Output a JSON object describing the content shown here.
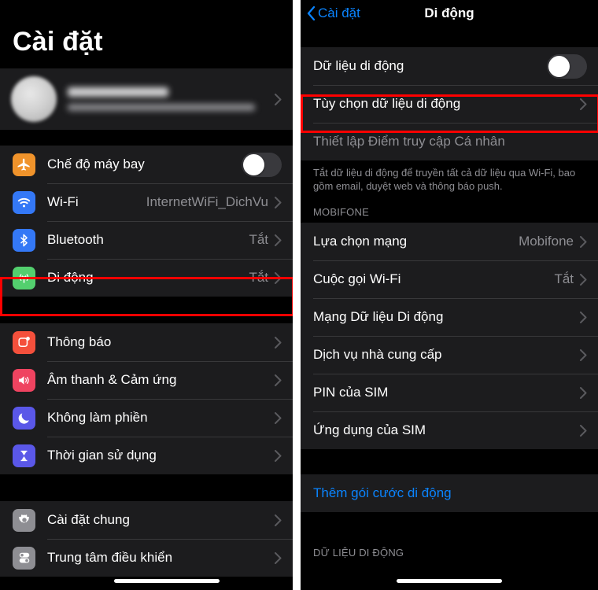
{
  "left_panel": {
    "title": "Cài đặt",
    "profile": {
      "name_redacted": "",
      "subtitle_redacted": ""
    },
    "group1": [
      {
        "label": "Chế độ máy bay",
        "control": "toggle",
        "toggle_on": false,
        "icon": "airplane-icon",
        "icon_color": "#f0932b"
      },
      {
        "label": "Wi-Fi",
        "value": "InternetWiFi_DichVu",
        "control": "chevron",
        "icon": "wifi-icon",
        "icon_color": "#3478f6"
      },
      {
        "label": "Bluetooth",
        "value": "Tắt",
        "control": "chevron",
        "icon": "bluetooth-icon",
        "icon_color": "#3478f6"
      },
      {
        "label": "Di động",
        "value": "Tắt",
        "control": "chevron",
        "icon": "cellular-icon",
        "icon_color": "#53cf6e",
        "highlighted": true
      }
    ],
    "group2": [
      {
        "label": "Thông báo",
        "control": "chevron",
        "icon": "notifications-icon",
        "icon_color": "#f4503c"
      },
      {
        "label": "Âm thanh & Cảm ứng",
        "control": "chevron",
        "icon": "sound-icon",
        "icon_color": "#ef4360"
      },
      {
        "label": "Không làm phiền",
        "control": "chevron",
        "icon": "moon-icon",
        "icon_color": "#5a57e8"
      },
      {
        "label": "Thời gian sử dụng",
        "control": "chevron",
        "icon": "hourglass-icon",
        "icon_color": "#5a57e8"
      }
    ],
    "group3": [
      {
        "label": "Cài đặt chung",
        "control": "chevron",
        "icon": "gear-icon",
        "icon_color": "#8e8e93"
      },
      {
        "label": "Trung tâm điều khiển",
        "control": "chevron",
        "icon": "control-center-icon",
        "icon_color": "#8e8e93"
      }
    ]
  },
  "right_panel": {
    "back_label": "Cài đặt",
    "nav_title": "Di động",
    "group1": [
      {
        "label": "Dữ liệu di động",
        "control": "toggle",
        "toggle_on": false
      },
      {
        "label": "Tùy chọn dữ liệu di động",
        "control": "chevron",
        "highlighted": true
      },
      {
        "label": "Thiết lập Điểm truy cập Cá nhân",
        "control": "none",
        "dimmed": true
      }
    ],
    "footer_note": "Tắt dữ liệu di động để truyền tất cả dữ liệu qua Wi-Fi, bao gồm email, duyệt web và thông báo push.",
    "section_header": "MOBIFONE",
    "group2": [
      {
        "label": "Lựa chọn mạng",
        "value": "Mobifone",
        "control": "chevron"
      },
      {
        "label": "Cuộc gọi Wi-Fi",
        "value": "Tắt",
        "control": "chevron"
      },
      {
        "label": "Mạng Dữ liệu Di động",
        "control": "chevron"
      },
      {
        "label": "Dịch vụ nhà cung cấp",
        "control": "chevron"
      },
      {
        "label": "PIN của SIM",
        "control": "chevron"
      },
      {
        "label": "Ứng dụng của SIM",
        "control": "chevron"
      }
    ],
    "group3": [
      {
        "label": "Thêm gói cước di động",
        "control": "none",
        "link": true
      }
    ],
    "bottom_section_header": "DỮ LIỆU DI ĐỘNG"
  },
  "colors": {
    "accent_blue": "#0a84ff",
    "highlight_red": "#ff0000",
    "list_bg": "#1c1c1e",
    "screen_bg": "#000000",
    "secondary_text": "#8e8e93"
  }
}
